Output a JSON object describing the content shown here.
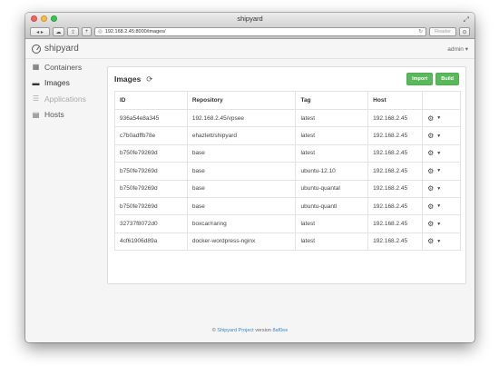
{
  "window": {
    "title": "shipyard"
  },
  "browser": {
    "url": "192.168.2.45:8000/images/",
    "reader_label": "Reader"
  },
  "navbar": {
    "brand": "shipyard",
    "user": "admin ▾"
  },
  "sidebar": {
    "items": [
      {
        "label": "Containers",
        "icon": "grid-icon"
      },
      {
        "label": "Images",
        "icon": "hdd-icon"
      },
      {
        "label": "Applications",
        "icon": "list-icon"
      },
      {
        "label": "Hosts",
        "icon": "server-icon"
      }
    ]
  },
  "panel": {
    "title": "Images",
    "import_label": "Import",
    "build_label": "Build"
  },
  "table": {
    "columns": [
      "ID",
      "Repository",
      "Tag",
      "Host"
    ],
    "rows": [
      [
        "936a54e8a345",
        "192.168.2.45/vpsee",
        "latest",
        "192.168.2.45"
      ],
      [
        "c7b0adffb78e",
        "ehazlett/shipyard",
        "latest",
        "192.168.2.45"
      ],
      [
        "b750fe79269d",
        "base",
        "latest",
        "192.168.2.45"
      ],
      [
        "b750fe79269d",
        "base",
        "ubuntu-12.10",
        "192.168.2.45"
      ],
      [
        "b750fe79269d",
        "base",
        "ubuntu-quantal",
        "192.168.2.45"
      ],
      [
        "b750fe79269d",
        "base",
        "ubuntu-quantl",
        "192.168.2.45"
      ],
      [
        "32737f8072d0",
        "boxcar/raring",
        "latest",
        "192.168.2.45"
      ],
      [
        "4cf61906d89a",
        "docker-wordpress-nginx",
        "latest",
        "192.168.2.45"
      ]
    ]
  },
  "footer": {
    "prefix": "©",
    "link": "Shipyard Project",
    "middle": "version",
    "version": "8af0ee"
  }
}
